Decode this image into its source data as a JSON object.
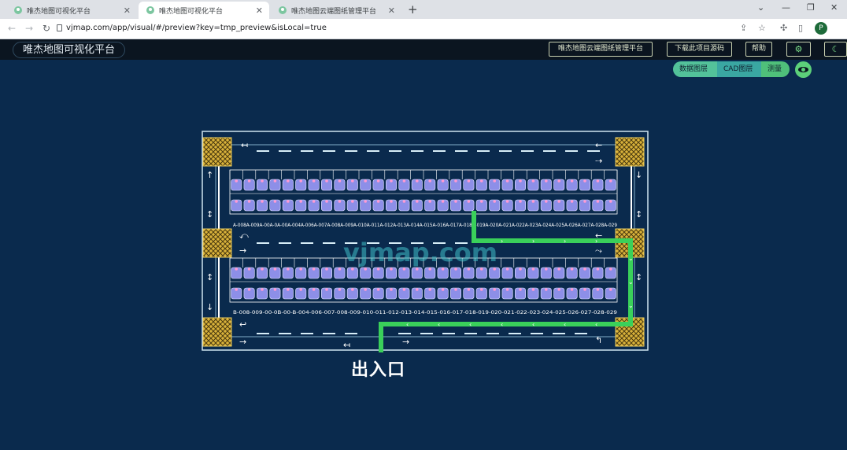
{
  "browser": {
    "tabs": [
      {
        "title": "唯杰地图可视化平台"
      },
      {
        "title": "唯杰地图可视化平台"
      },
      {
        "title": "唯杰地图云端图纸管理平台"
      }
    ],
    "new_tab_label": "+",
    "address": "vjmap.com/app/visual/#/preview?key=tmp_preview&isLocal=true",
    "profile_initial": "P"
  },
  "app": {
    "title": "唯杰地图可视化平台",
    "buttons": {
      "cloud": "唯杰地图云端图纸管理平台",
      "download": "下载此项目源码",
      "help": "帮助"
    }
  },
  "layer_toggles": [
    {
      "label": "数据图层",
      "color": "#53c29a"
    },
    {
      "label": "CAD图层",
      "color": "#3aa7a2"
    },
    {
      "label": "测量",
      "color": "#4fc07a"
    }
  ],
  "map": {
    "entrance_label": "出入口",
    "watermark": "vjmap.com",
    "upper_row_labels": "A-008A-009A-00A-0A-00A-004A-006A-007A-008A-009A-010A-011A-012A-013A-014A-015A-016A-017A-018A-019A-020A-021A-022A-023A-024A-025A-026A-027A-028A-029",
    "lower_row_labels": "B-008-009-00-0B-00-B-004-006-007-008-009-010-011-012-013-014-015-016-017-018-019-020-021-022-023-024-025-026-027-028-029",
    "route_color": "#3ad05a",
    "border_color": "#d0e4f0",
    "corner_fill": "#d9b23a"
  }
}
